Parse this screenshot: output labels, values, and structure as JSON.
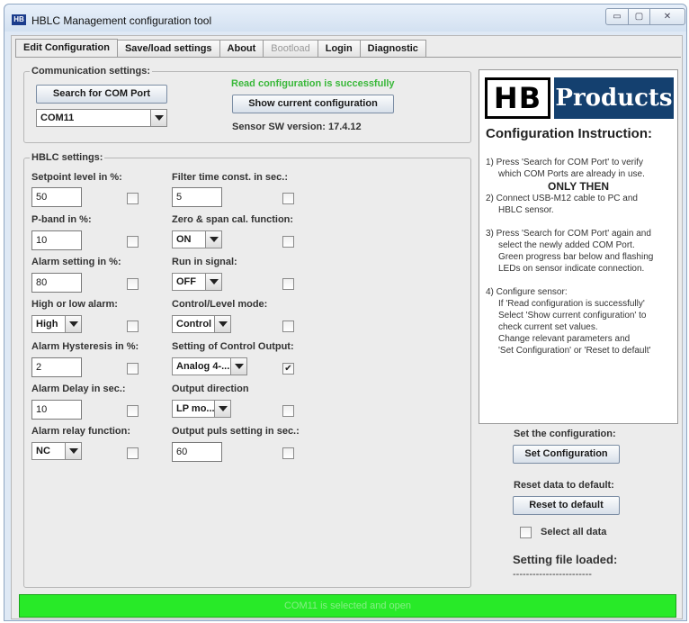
{
  "window": {
    "title": "HBLC Management configuration tool",
    "icon_label": "HB",
    "controls": {
      "minimize": "▭",
      "maximize": "▢",
      "close": "✕"
    }
  },
  "tabs": [
    {
      "label": "Edit Configuration",
      "state": "active"
    },
    {
      "label": "Save/load settings",
      "state": "normal"
    },
    {
      "label": "About",
      "state": "normal"
    },
    {
      "label": "Bootload",
      "state": "disabled"
    },
    {
      "label": "Login",
      "state": "normal"
    },
    {
      "label": "Diagnostic",
      "state": "normal"
    }
  ],
  "communication": {
    "legend": "Communication settings:",
    "search_button": "Search for COM Port",
    "com_port": "COM11",
    "status_message": "Read configuration is successfully",
    "show_button": "Show current configuration",
    "sw_version": "Sensor SW version: 17.4.12"
  },
  "hblc": {
    "legend": "HBLC settings:",
    "left": [
      {
        "label": "Setpoint level in %:",
        "value": "50",
        "kind": "input",
        "checked": false
      },
      {
        "label": "P-band in %:",
        "value": "10",
        "kind": "input",
        "checked": false
      },
      {
        "label": "Alarm setting in %:",
        "value": "80",
        "kind": "input",
        "checked": false
      },
      {
        "label": "High or low alarm:",
        "value": "High",
        "kind": "combo",
        "checked": false
      },
      {
        "label": "Alarm Hysteresis in %:",
        "value": "2",
        "kind": "input",
        "checked": false
      },
      {
        "label": "Alarm Delay in sec.:",
        "value": "10",
        "kind": "input",
        "checked": false
      },
      {
        "label": "Alarm relay function:",
        "value": "NC",
        "kind": "combo",
        "checked": false
      }
    ],
    "right": [
      {
        "label": "Filter time const. in sec.:",
        "value": "5",
        "kind": "input",
        "checked": false
      },
      {
        "label": "Zero & span cal. function:",
        "value": "ON",
        "kind": "combo",
        "checked": false
      },
      {
        "label": "Run in signal:",
        "value": "OFF",
        "kind": "combo",
        "checked": false
      },
      {
        "label": "Control/Level mode:",
        "value": "Control",
        "kind": "combo",
        "checked": false
      },
      {
        "label": "Setting of Control Output:",
        "value": "Analog 4-...",
        "kind": "combo",
        "checked": true
      },
      {
        "label": "Output direction",
        "value": "LP mo...",
        "kind": "combo",
        "checked": false
      },
      {
        "label": "Output puls setting in sec.:",
        "value": "60",
        "kind": "input",
        "checked": false
      }
    ]
  },
  "instructions": {
    "logo_hb": "HB",
    "logo_products": "Products",
    "title": "Configuration Instruction:",
    "step1_l1": "1) Press 'Search for COM Port' to verify",
    "step1_l2": "which COM Ports are already in use.",
    "only_then": "ONLY THEN",
    "step2_l1": "2) Connect USB-M12 cable to PC and",
    "step2_l2": "HBLC sensor.",
    "step3_l1": "3) Press 'Search for COM Port' again and",
    "step3_l2": "select the newly added COM Port.",
    "step3_l3": "Green progress bar below and flashing",
    "step3_l4": "LEDs on sensor indicate connection.",
    "step4_l1": "4) Configure sensor:",
    "step4_l2": "If 'Read configuration is successfully'",
    "step4_l3": "Select 'Show current configuration' to",
    "step4_l4": "check current set values.",
    "step4_l5": "Change relevant parameters and",
    "step4_l6": "'Set Configuration' or 'Reset to default'"
  },
  "actions": {
    "set_label": "Set the configuration:",
    "set_button": "Set Configuration",
    "reset_label": "Reset data to default:",
    "reset_button": "Reset to default",
    "select_all": "Select all data",
    "select_all_checked": false,
    "file_loaded_label": "Setting file loaded:",
    "file_loaded_value": "------------------------"
  },
  "status_bar": {
    "text": "COM11 is selected and open",
    "color": "#28ea28"
  }
}
